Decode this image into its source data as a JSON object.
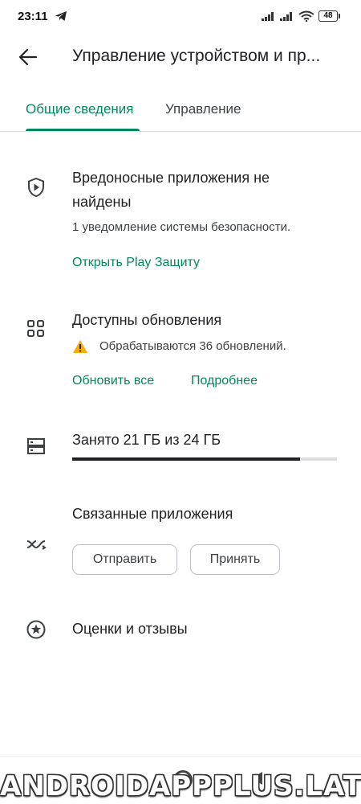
{
  "status_bar": {
    "time": "23:11",
    "telegram_icon": "telegram-icon",
    "battery": "48"
  },
  "app_bar": {
    "back_icon": "arrow-back-icon",
    "title": "Управление устройством и пр..."
  },
  "tabs": [
    {
      "label": "Общие сведения",
      "active": true
    },
    {
      "label": "Управление",
      "active": false
    }
  ],
  "protection": {
    "icon": "shield-play-icon",
    "title_line1": "Вредоносные приложения не",
    "title_line2": "найдены",
    "subtitle": "1 уведомление системы безопасности.",
    "link": "Открыть Play Защиту"
  },
  "updates": {
    "icon": "apps-grid-icon",
    "title": "Доступны обновления",
    "warning_icon": "warning-icon",
    "status": "Обрабатываются 36 обновлений.",
    "update_all": "Обновить все",
    "details": "Подробнее"
  },
  "storage": {
    "icon": "storage-icon",
    "label": "Занято 21 ГБ из 24 ГБ",
    "used_fraction": 0.86
  },
  "linked_apps": {
    "icon": "share-apps-icon",
    "title": "Связанные приложения",
    "send": "Отправить",
    "receive": "Принять"
  },
  "ratings": {
    "icon": "star-circle-icon",
    "title": "Оценки и отзывы"
  },
  "watermark": "ANDROIDAPPPLUS.LAT",
  "colors": {
    "accent": "#01875f",
    "text": "#202124",
    "warning": "#f9ab00"
  }
}
